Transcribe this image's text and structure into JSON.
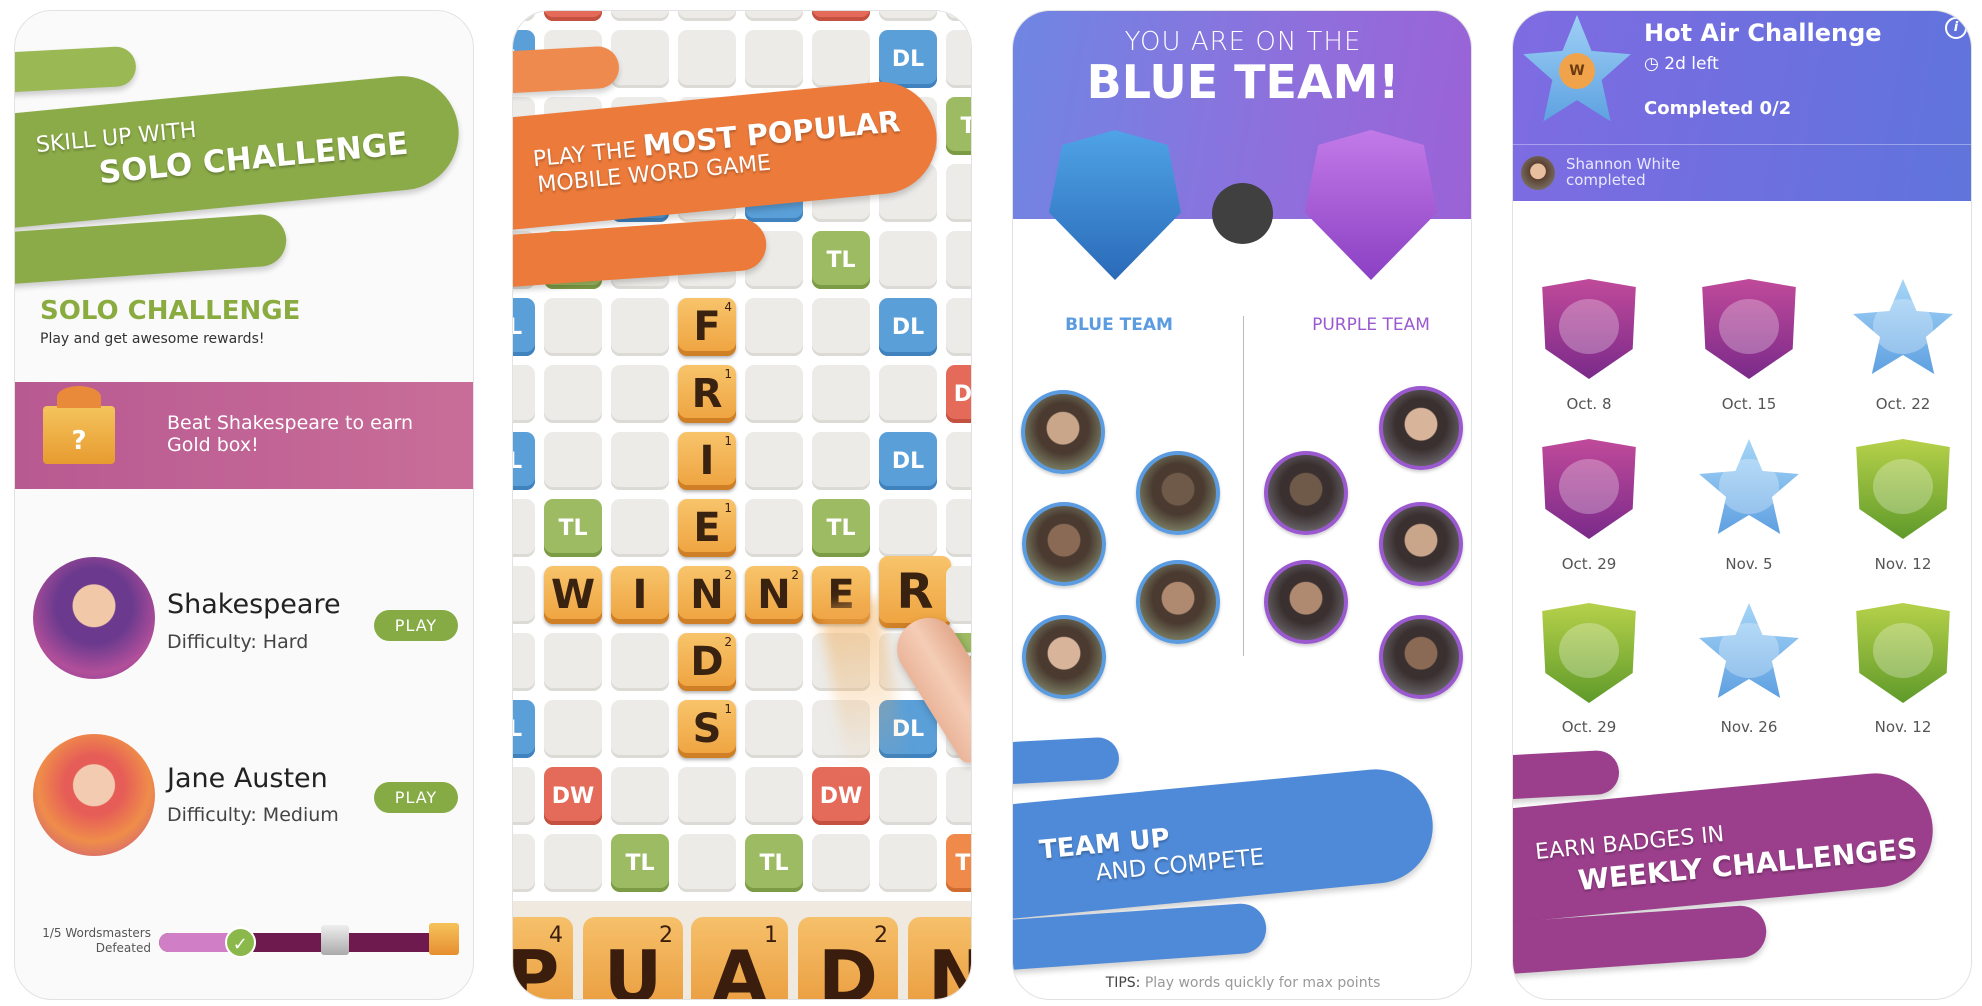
{
  "colors": {
    "solo_green": "#8bab48",
    "orange": "#ec7a3a",
    "team_blue": "#4f8ad8",
    "badge_purple": "#9b3f8c",
    "purple_team": "#9b59d0",
    "blue_team": "#5b9be0"
  },
  "panel1": {
    "banner_line1": "SKILL UP WITH",
    "banner_line2": "SOLO CHALLENGE",
    "heading": "SOLO CHALLENGE",
    "subtitle": "Play and get awesome rewards!",
    "reward_text_line1": "Beat Shakespeare to earn",
    "reward_text_line2": "Gold box!",
    "reward_icon": "gift-box-icon",
    "reward_icon_glyph": "?",
    "opponents": [
      {
        "name": "Shakespeare",
        "difficulty": "Difficulty: Hard",
        "button": "PLAY"
      },
      {
        "name": "Jane Austen",
        "difficulty": "Difficulty: Medium",
        "button": "PLAY"
      }
    ],
    "progress": {
      "label_line1": "1/5 Wordsmasters",
      "label_line2": "Defeated",
      "defeated": 1,
      "total": 5
    }
  },
  "panel2": {
    "banner_line1_a": "PLAY THE ",
    "banner_line1_b": "MOST POPULAR",
    "banner_line2": "MOBILE WORD GAME",
    "board": [
      [
        "",
        "DW",
        "",
        "",
        "",
        "DW",
        "",
        ""
      ],
      [
        "DL",
        "",
        "",
        "",
        "",
        "",
        "DL",
        ""
      ],
      [
        "",
        "",
        "",
        "",
        "",
        "",
        "",
        "TL"
      ],
      [
        "",
        "",
        "DL",
        "",
        "DL",
        "",
        "",
        ""
      ],
      [
        "",
        "TL",
        "",
        "",
        "",
        "TL",
        "",
        ""
      ],
      [
        "DL",
        "",
        "",
        {
          "letter": "F",
          "points": 4
        },
        "",
        "",
        "DL",
        ""
      ],
      [
        "",
        "",
        "",
        {
          "letter": "R",
          "points": 1
        },
        "",
        "",
        "",
        "DW"
      ],
      [
        "DL",
        "",
        "",
        {
          "letter": "I",
          "points": 1
        },
        "",
        "",
        "DL",
        ""
      ],
      [
        "",
        "TL",
        "",
        {
          "letter": "E",
          "points": 1
        },
        "",
        "TL",
        "",
        ""
      ],
      [
        "",
        {
          "letter": "W"
        },
        {
          "letter": "I"
        },
        {
          "letter": "N",
          "points": 2
        },
        {
          "letter": "N",
          "points": 2
        },
        {
          "letter": "E"
        },
        {
          "letter": "R"
        },
        ""
      ],
      [
        "",
        "",
        "",
        {
          "letter": "D",
          "points": 2
        },
        "",
        "",
        "",
        "TL"
      ],
      [
        "DL",
        "",
        "",
        {
          "letter": "S",
          "points": 1
        },
        "",
        "",
        "DL",
        ""
      ],
      [
        "",
        "DW",
        "",
        "",
        "",
        "DW",
        "",
        ""
      ],
      [
        "",
        "",
        "TL",
        "",
        "TL",
        "",
        "",
        "TW"
      ]
    ],
    "rack": [
      {
        "letter": "P",
        "points": 4
      },
      {
        "letter": "U",
        "points": 2
      },
      {
        "letter": "A",
        "points": 1
      },
      {
        "letter": "D",
        "points": 2
      },
      {
        "letter": "N"
      }
    ]
  },
  "panel3": {
    "title_small": "YOU  ARE ON THE",
    "title_big": "BLUE TEAM!",
    "blue_team_label": "BLUE TEAM",
    "purple_team_label": "PURPLE TEAM",
    "blue_members": 5,
    "purple_members": 5,
    "banner_line1": "TEAM UP",
    "banner_line2": "AND COMPETE",
    "tips_label": "TIPS:",
    "tips_text": " Play words quickly for max points"
  },
  "panel4": {
    "challenge_title": "Hot Air Challenge",
    "time_left": "2d left",
    "completed": "Completed 0/2",
    "info_icon": "i",
    "friend_name": "Shannon White",
    "friend_status": "completed",
    "badges": [
      {
        "label": "Oct. 8",
        "style": "purple-shield"
      },
      {
        "label": "Oct. 15",
        "style": "purple-shield"
      },
      {
        "label": "Oct. 22",
        "style": "blue-star"
      },
      {
        "label": "Oct. 29",
        "style": "purple-shield"
      },
      {
        "label": "Nov. 5",
        "style": "blue-star"
      },
      {
        "label": "Nov. 12",
        "style": "green-shield"
      },
      {
        "label": "Oct. 29",
        "style": "green-shield"
      },
      {
        "label": "Nov. 26",
        "style": "blue-star"
      },
      {
        "label": "Nov. 12",
        "style": "green-shield"
      }
    ],
    "banner_line1": "EARN BADGES IN",
    "banner_line2": "WEEKLY CHALLENGES"
  }
}
